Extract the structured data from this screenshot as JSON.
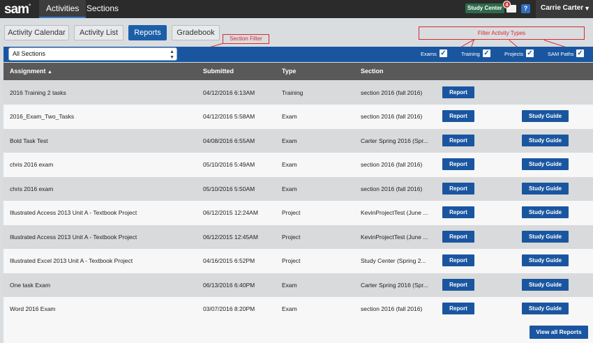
{
  "topnav": {
    "logo": "sam",
    "tabs": [
      {
        "label": "Activities"
      },
      {
        "label": "Sections"
      }
    ],
    "study_center": "Study Center",
    "notification_count": "4",
    "help": "?",
    "user_name": "Carrie Carter"
  },
  "subtabs": [
    {
      "label": "Activity Calendar"
    },
    {
      "label": "Activity List"
    },
    {
      "label": "Reports"
    },
    {
      "label": "Gradebook"
    }
  ],
  "annotations": {
    "section_filter": "Section Filter",
    "filter_types": "Filter Activity Types"
  },
  "filter": {
    "section_value": "All Sections",
    "types": [
      {
        "label": "Exams",
        "checked": true
      },
      {
        "label": "Training",
        "checked": true
      },
      {
        "label": "Projects",
        "checked": true
      },
      {
        "label": "SAM Paths",
        "checked": true
      }
    ]
  },
  "table": {
    "headers": {
      "assignment": "Assignment",
      "submitted": "Submitted",
      "type": "Type",
      "section": "Section"
    },
    "rows": [
      {
        "assignment": "2016 Training 2 tasks",
        "submitted": "04/12/2016 6:13AM",
        "type": "Training",
        "section": "section 2016 (fall 2016)",
        "report": "Report",
        "guide": ""
      },
      {
        "assignment": "2016_Exam_Two_Tasks",
        "submitted": "04/12/2016 5:58AM",
        "type": "Exam",
        "section": "section 2016 (fall 2016)",
        "report": "Report",
        "guide": "Study Guide"
      },
      {
        "assignment": "Bold Task Test",
        "submitted": "04/08/2016 6:55AM",
        "type": "Exam",
        "section": "Carter Spring 2016 (Spr...",
        "report": "Report",
        "guide": "Study Guide"
      },
      {
        "assignment": "chris 2016 exam",
        "submitted": "05/10/2016 5:49AM",
        "type": "Exam",
        "section": "section 2016 (fall 2016)",
        "report": "Report",
        "guide": "Study Guide"
      },
      {
        "assignment": "chris 2016 exam",
        "submitted": "05/10/2016 5:50AM",
        "type": "Exam",
        "section": "section 2016 (fall 2016)",
        "report": "Report",
        "guide": "Study Guide"
      },
      {
        "assignment": "Illustrated Access 2013 Unit A - Textbook Project",
        "submitted": "06/12/2015 12:24AM",
        "type": "Project",
        "section": "KevinProjectTest (June ...",
        "report": "Report",
        "guide": "Study Guide"
      },
      {
        "assignment": "Illustrated Access 2013 Unit A - Textbook Project",
        "submitted": "06/12/2015 12:45AM",
        "type": "Project",
        "section": "KevinProjectTest (June ...",
        "report": "Report",
        "guide": "Study Guide"
      },
      {
        "assignment": "Illustrated Excel 2013 Unit A - Textbook Project",
        "submitted": "04/16/2015 6:52PM",
        "type": "Project",
        "section": "Study Center (Spring 2...",
        "report": "Report",
        "guide": "Study Guide"
      },
      {
        "assignment": "One task Exam",
        "submitted": "06/13/2016 6:40PM",
        "type": "Exam",
        "section": "Carter Spring 2016 (Spr...",
        "report": "Report",
        "guide": "Study Guide"
      },
      {
        "assignment": "Word 2016 Exam",
        "submitted": "03/07/2016 8:20PM",
        "type": "Exam",
        "section": "section 2016 (fall 2016)",
        "report": "Report",
        "guide": "Study Guide"
      }
    ]
  },
  "footer": {
    "view_all": "View all Reports"
  }
}
